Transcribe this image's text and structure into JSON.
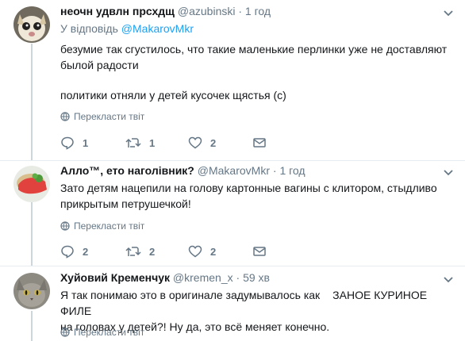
{
  "tweets": [
    {
      "name": "неочн удвлн прсхдщ",
      "handle": "@azubinski",
      "dot": "·",
      "time": "1 год",
      "reply_prefix": "У відповідь",
      "reply_to": "@MakarovMkr",
      "lines": [
        "безумие так сгустилось, что такие маленькие перлинки уже не доставляют былой радости",
        "политики отняли у детей кусочек щястья (c)"
      ],
      "translate": "Перекласти твіт",
      "reply_count": "1",
      "retweet_count": "1",
      "like_count": "2",
      "avatar_icon": "cat-avatar-icon"
    },
    {
      "name": "Алло™, ето наголівник?",
      "handle": "@MakarovMkr",
      "dot": "·",
      "time": "1 год",
      "lines": [
        "Зато детям нацепили на голову картонные вагины с клитором, стыдливо прикрытым петрушечкой!"
      ],
      "translate": "Перекласти твіт",
      "reply_count": "2",
      "retweet_count": "2",
      "like_count": "2",
      "avatar_icon": "food-avatar-icon"
    },
    {
      "name": "Хуйовий Кременчук",
      "handle": "@kremen_x",
      "dot": "·",
      "time": "59 хв",
      "lines_a": "Я так понимаю это в оригинале задумывалось как",
      "lines_b": "ЗАНОЕ КУРИНОЕ ФИЛЕ",
      "lines_c": "на головах у детей?! Ну да, это всё меняет конечно.",
      "translate": "Перекласти твіт",
      "avatar_icon": "cat-avatar-icon"
    }
  ],
  "colors": {
    "accent": "#1da1f2",
    "secondary_text": "#657786",
    "divider": "#e6ecf0",
    "thread_line": "#ccd6dd"
  },
  "icons": [
    "reply-icon",
    "retweet-icon",
    "like-icon",
    "dm-icon",
    "globe-icon",
    "chevron-down-icon"
  ]
}
